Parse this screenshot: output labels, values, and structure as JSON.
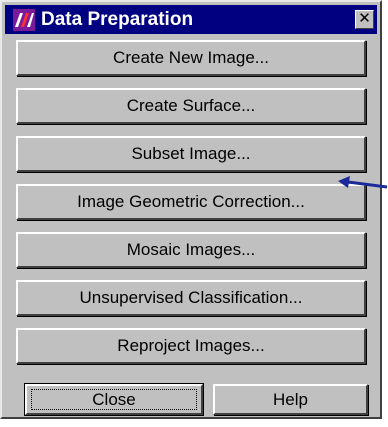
{
  "window": {
    "title": "Data Preparation",
    "close_glyph": "✕",
    "titlebar_color": "#000080",
    "icon": "app-logo-icon"
  },
  "buttons": [
    {
      "label": "Create New Image..."
    },
    {
      "label": "Create Surface..."
    },
    {
      "label": "Subset Image..."
    },
    {
      "label": "Image Geometric Correction..."
    },
    {
      "label": "Mosaic Images..."
    },
    {
      "label": "Unsupervised Classification..."
    },
    {
      "label": "Reproject Images..."
    }
  ],
  "footer": {
    "close_label": "Close",
    "help_label": "Help"
  },
  "annotation": {
    "arrow_icon": "blue-pointer-arrow-icon",
    "arrow_color": "#1a2a9a"
  }
}
